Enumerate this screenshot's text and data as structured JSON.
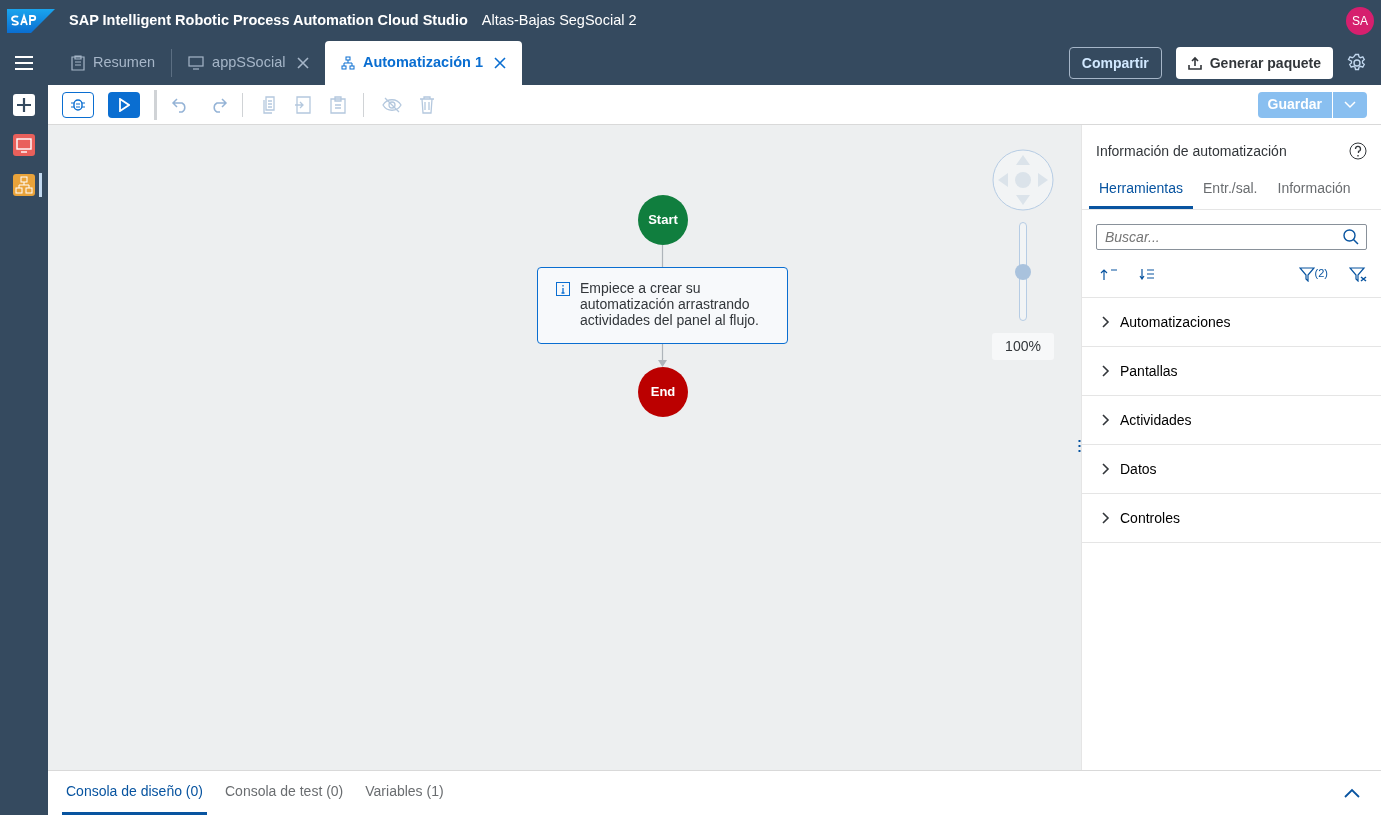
{
  "header": {
    "product": "SAP Intelligent Robotic Process Automation Cloud Studio",
    "project": "Altas-Bajas SegSocial 2",
    "avatar": "SA"
  },
  "rail": [
    {
      "kind": "screen",
      "selected": false
    },
    {
      "kind": "flow",
      "selected": true
    }
  ],
  "tabs": [
    {
      "label": "Resumen",
      "kind": "overview",
      "closable": false,
      "selected": false
    },
    {
      "label": "appSSocial",
      "kind": "screen",
      "closable": true,
      "selected": false
    },
    {
      "label": "Automatización 1",
      "kind": "flow",
      "closable": true,
      "selected": true
    }
  ],
  "header_buttons": {
    "share": "Compartir",
    "generate": "Generar paquete"
  },
  "toolbar": {
    "save": "Guardar",
    "save_disabled": true
  },
  "canvas": {
    "start": "Start",
    "end": "End",
    "hint": "Empiece a crear su automatización arrastrando actividades del panel al flujo.",
    "zoom": {
      "level": 0.5,
      "reading": "100%"
    }
  },
  "panel": {
    "title": "Información de automatización",
    "tabs": [
      {
        "label": "Herramientas",
        "selected": true
      },
      {
        "label": "Entr./sal.",
        "selected": false
      },
      {
        "label": "Información",
        "selected": false
      }
    ],
    "search": {
      "placeholder": "Buscar..."
    },
    "filter_count": "(2)",
    "sections": [
      {
        "label": "Automatizaciones",
        "expanded": false
      },
      {
        "label": "Pantallas",
        "expanded": false
      },
      {
        "label": "Actividades",
        "expanded": false
      },
      {
        "label": "Datos",
        "expanded": false
      },
      {
        "label": "Controles",
        "expanded": false
      }
    ]
  },
  "console_tabs": [
    {
      "label": "Consola de diseño (0)",
      "selected": true
    },
    {
      "label": "Consola de test (0)",
      "selected": false
    },
    {
      "label": "Variables (1)",
      "selected": false
    }
  ]
}
